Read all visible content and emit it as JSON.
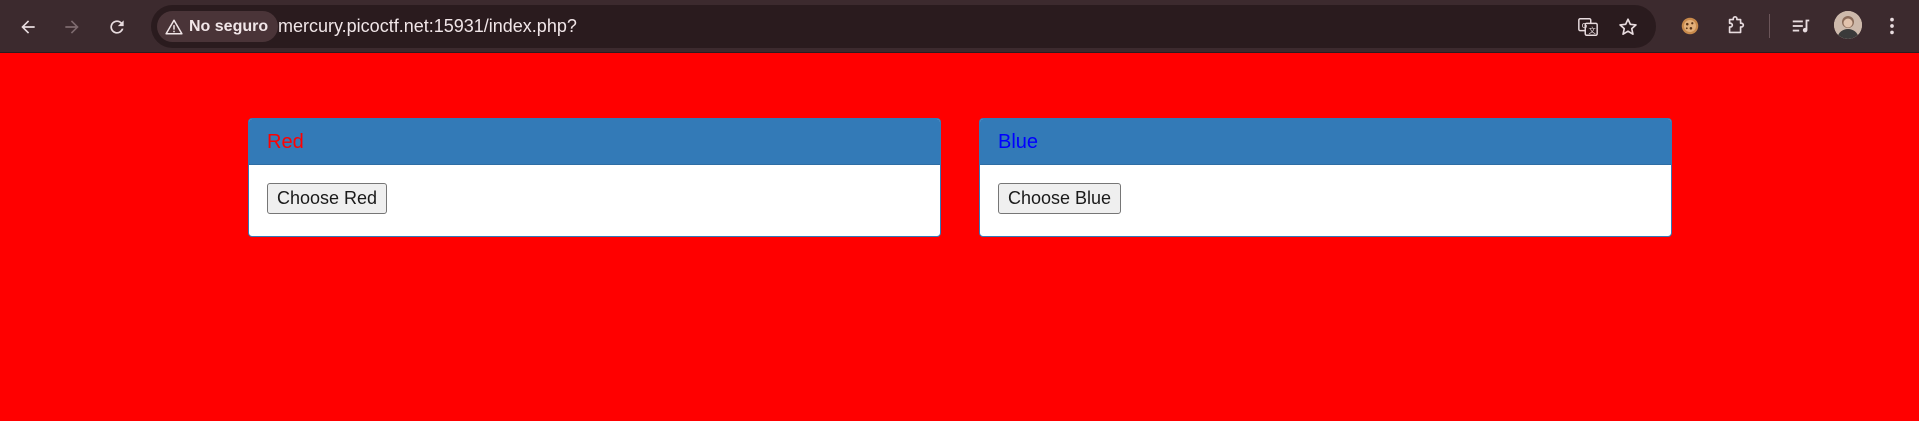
{
  "browser": {
    "security_label": "No seguro",
    "url": "mercury.picoctf.net:15931/index.php?",
    "icons": {
      "back": "back-arrow-icon",
      "forward": "forward-arrow-icon",
      "reload": "reload-icon",
      "warning": "warning-triangle-icon",
      "translate": "translate-icon",
      "bookmark": "star-icon",
      "cookie": "cookie-icon",
      "extensions": "puzzle-icon",
      "reading_list": "reading-list-icon",
      "profile": "avatar",
      "menu": "kebab-menu-icon"
    }
  },
  "page": {
    "background_color": "#ff0000",
    "panels": [
      {
        "title": "Red",
        "title_color": "#ff0000",
        "button_label": "Choose Red"
      },
      {
        "title": "Blue",
        "title_color": "#0000ff",
        "button_label": "Choose Blue"
      }
    ],
    "panel_header_color": "#337ab7"
  }
}
